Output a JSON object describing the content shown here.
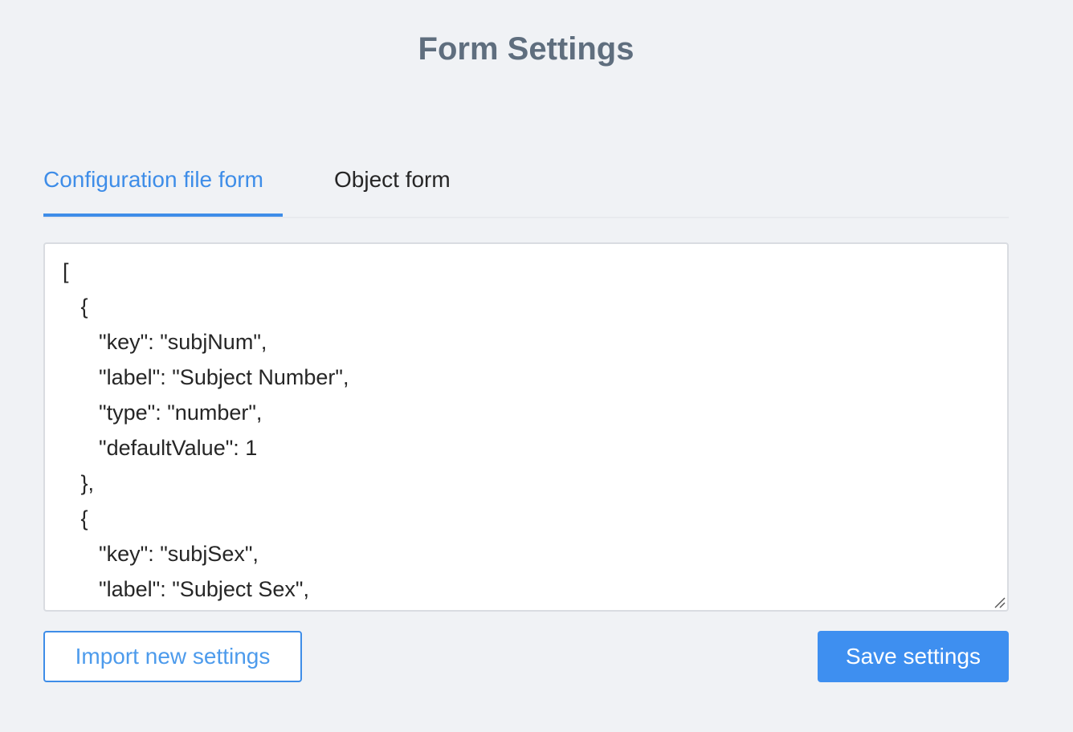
{
  "header": {
    "title": "Form Settings"
  },
  "tabs": [
    {
      "label": "Configuration file form",
      "active": true
    },
    {
      "label": "Object form",
      "active": false
    }
  ],
  "editor": {
    "lines": [
      "[",
      "   {",
      "      \"key\": \"subjNum\",",
      "      \"label\": \"Subject Number\",",
      "      \"type\": \"number\",",
      "      \"defaultValue\": 1",
      "   },",
      "   {",
      "      \"key\": \"subjSex\",",
      "      \"label\": \"Subject Sex\","
    ]
  },
  "actions": {
    "import_label": "Import new settings",
    "save_label": "Save settings"
  },
  "colors": {
    "accent": "#3e8de8",
    "background": "#f0f2f5",
    "title": "#5f6e7e"
  }
}
